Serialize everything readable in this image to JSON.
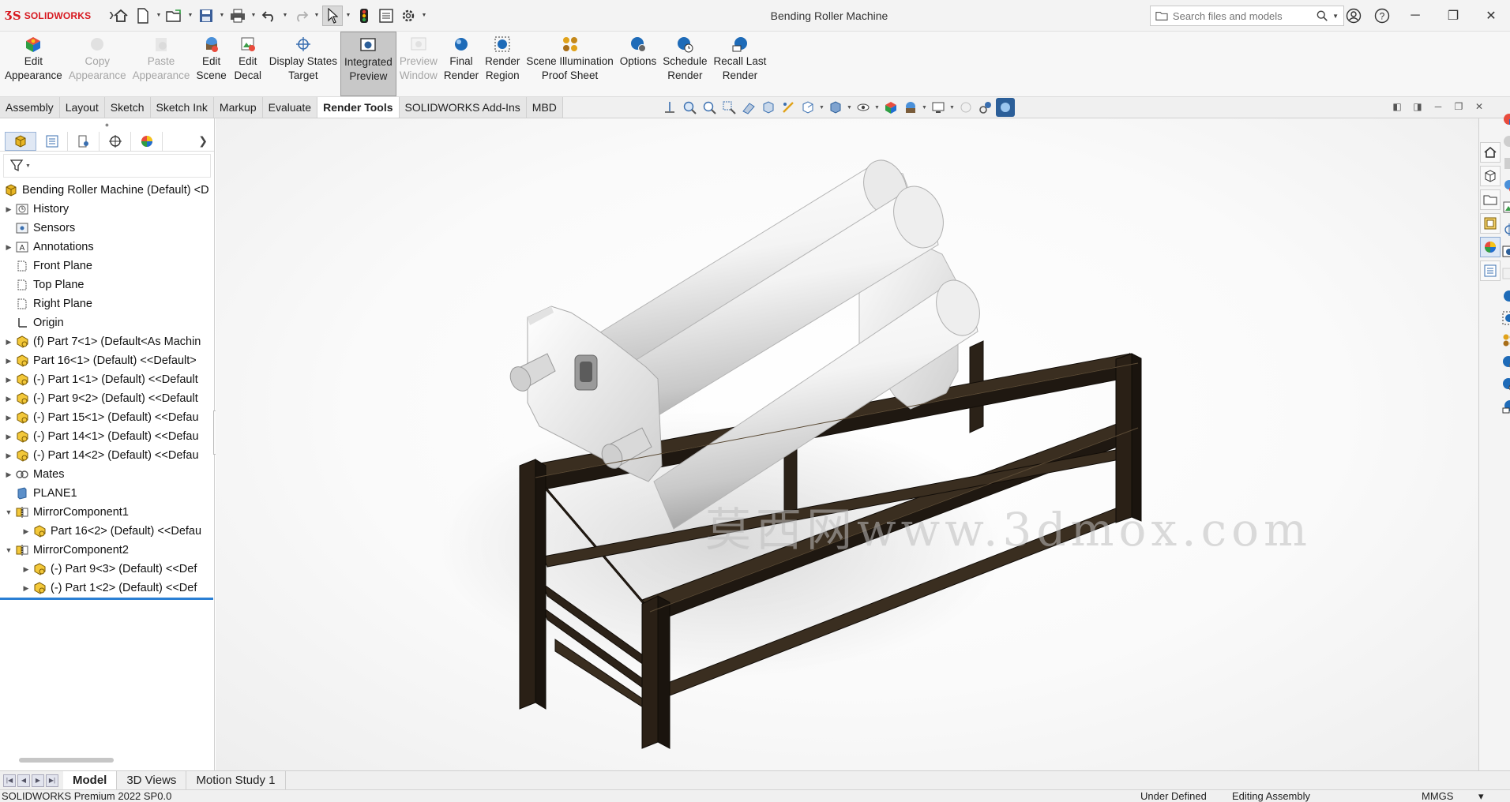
{
  "app": {
    "brand": "SOLIDWORKS",
    "window_title": "Bending Roller Machine",
    "search_placeholder": "Search files and models",
    "colors": {
      "brand_red": "#d71920",
      "accent_blue": "#2a7fd4",
      "ribbon_bg": "#f7f7f7"
    }
  },
  "quick_access": [
    "home-icon",
    "new-document-icon",
    "open-icon",
    "save-icon",
    "print-icon",
    "undo-icon",
    "redo-icon",
    "select-icon",
    "traffic-light-icon",
    "file-properties-icon",
    "options-gear-icon"
  ],
  "ribbon": {
    "buttons": [
      {
        "label": "Edit\nAppearance",
        "icon": "edit-appearance-icon",
        "enabled": true
      },
      {
        "label": "Copy\nAppearance",
        "icon": "copy-appearance-icon",
        "enabled": false
      },
      {
        "label": "Paste\nAppearance",
        "icon": "paste-appearance-icon",
        "enabled": false
      },
      {
        "label": "Edit\nScene",
        "icon": "edit-scene-icon",
        "enabled": true
      },
      {
        "label": "Edit\nDecal",
        "icon": "edit-decal-icon",
        "enabled": true
      },
      {
        "label": "Display States\nTarget",
        "icon": "display-states-target-icon",
        "enabled": true
      },
      {
        "label": "Integrated\nPreview",
        "icon": "integrated-preview-icon",
        "enabled": true,
        "pressed": true
      },
      {
        "label": "Preview\nWindow",
        "icon": "preview-window-icon",
        "enabled": false
      },
      {
        "label": "Final\nRender",
        "icon": "final-render-icon",
        "enabled": true
      },
      {
        "label": "Render\nRegion",
        "icon": "render-region-icon",
        "enabled": true
      },
      {
        "label": "Scene Illumination\nProof Sheet",
        "icon": "scene-illumination-icon",
        "enabled": true
      },
      {
        "label": "Options",
        "icon": "render-options-icon",
        "enabled": true
      },
      {
        "label": "Schedule\nRender",
        "icon": "schedule-render-icon",
        "enabled": true
      },
      {
        "label": "Recall Last\nRender",
        "icon": "recall-last-render-icon",
        "enabled": true
      }
    ]
  },
  "command_tabs": [
    "Assembly",
    "Layout",
    "Sketch",
    "Sketch Ink",
    "Markup",
    "Evaluate",
    "Render Tools",
    "SOLIDWORKS Add-Ins",
    "MBD"
  ],
  "active_command_tab": "Render Tools",
  "feature_tree": {
    "root": "Bending Roller Machine (Default) <D",
    "items": [
      {
        "label": "History",
        "icon": "history-folder-icon",
        "expandable": true,
        "indent": 1
      },
      {
        "label": "Sensors",
        "icon": "sensors-icon",
        "expandable": false,
        "indent": 1
      },
      {
        "label": "Annotations",
        "icon": "annotations-icon",
        "expandable": true,
        "indent": 1
      },
      {
        "label": "Front Plane",
        "icon": "plane-icon",
        "expandable": false,
        "indent": 1
      },
      {
        "label": "Top Plane",
        "icon": "plane-icon",
        "expandable": false,
        "indent": 1
      },
      {
        "label": "Right Plane",
        "icon": "plane-icon",
        "expandable": false,
        "indent": 1
      },
      {
        "label": "Origin",
        "icon": "origin-icon",
        "expandable": false,
        "indent": 1
      },
      {
        "label": "(f) Part 7<1> (Default<As Machin",
        "icon": "part-icon",
        "expandable": true,
        "indent": 1
      },
      {
        "label": "Part 16<1> (Default) <<Default>",
        "icon": "part-icon",
        "expandable": true,
        "indent": 1
      },
      {
        "label": "(-) Part 1<1> (Default) <<Default",
        "icon": "part-icon",
        "expandable": true,
        "indent": 1
      },
      {
        "label": "(-) Part 9<2> (Default) <<Default",
        "icon": "part-icon",
        "expandable": true,
        "indent": 1
      },
      {
        "label": "(-) Part 15<1> (Default) <<Defau",
        "icon": "part-icon",
        "expandable": true,
        "indent": 1
      },
      {
        "label": "(-) Part 14<1> (Default) <<Defau",
        "icon": "part-icon",
        "expandable": true,
        "indent": 1
      },
      {
        "label": "(-) Part 14<2> (Default) <<Defau",
        "icon": "part-icon",
        "expandable": true,
        "indent": 1
      },
      {
        "label": "Mates",
        "icon": "mates-icon",
        "expandable": true,
        "indent": 1
      },
      {
        "label": "PLANE1",
        "icon": "plane-solid-icon",
        "expandable": false,
        "indent": 1
      },
      {
        "label": "MirrorComponent1",
        "icon": "mirror-component-icon",
        "expandable": true,
        "expanded": true,
        "indent": 1
      },
      {
        "label": "Part 16<2> (Default) <<Defau",
        "icon": "part-icon",
        "expandable": true,
        "indent": 2
      },
      {
        "label": "MirrorComponent2",
        "icon": "mirror-component-icon",
        "expandable": true,
        "expanded": true,
        "indent": 1
      },
      {
        "label": "(-) Part 9<3> (Default) <<Def",
        "icon": "part-icon",
        "expandable": true,
        "indent": 2
      },
      {
        "label": "(-) Part 1<2> (Default) <<Def",
        "icon": "part-icon",
        "expandable": true,
        "indent": 2
      }
    ]
  },
  "viewport": {
    "watermark": "莫西网www.3dmox.com"
  },
  "bottom_tabs": [
    "Model",
    "3D Views",
    "Motion Study 1"
  ],
  "active_bottom_tab": "Model",
  "status": {
    "version": "SOLIDWORKS Premium 2022 SP0.0",
    "state": "Under Defined",
    "mode": "Editing Assembly",
    "units": "MMGS",
    "caret": "▾"
  }
}
